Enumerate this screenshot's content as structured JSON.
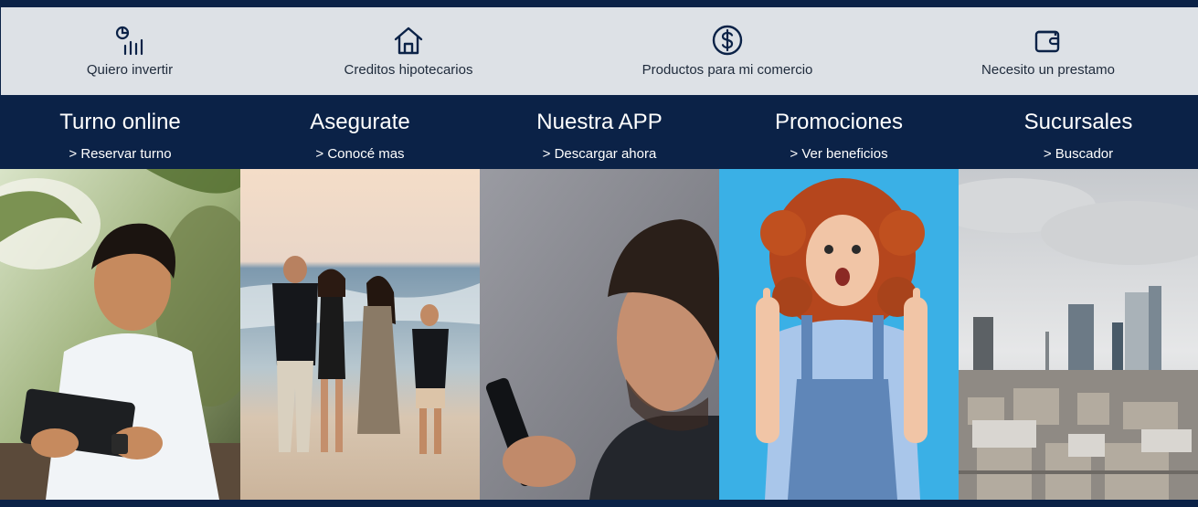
{
  "quick_links": [
    {
      "label": "Quiero invertir",
      "icon": "investment-chart-icon"
    },
    {
      "label": "Creditos hipotecarios",
      "icon": "house-icon"
    },
    {
      "label": "Productos para mi comercio",
      "icon": "dollar-coin-icon"
    },
    {
      "label": "Necesito un prestamo",
      "icon": "wallet-icon"
    }
  ],
  "features": [
    {
      "title": "Turno online",
      "link": "> Reservar turno"
    },
    {
      "title": "Asegurate",
      "link": "> Conocé mas"
    },
    {
      "title": "Nuestra APP",
      "link": "> Descargar ahora"
    },
    {
      "title": "Promociones",
      "link": "> Ver beneficios"
    },
    {
      "title": "Sucursales",
      "link": "> Buscador"
    }
  ],
  "colors": {
    "navy": "#0b2247",
    "quick_bg": "#dde1e6",
    "quick_text": "#1e2a3b"
  }
}
